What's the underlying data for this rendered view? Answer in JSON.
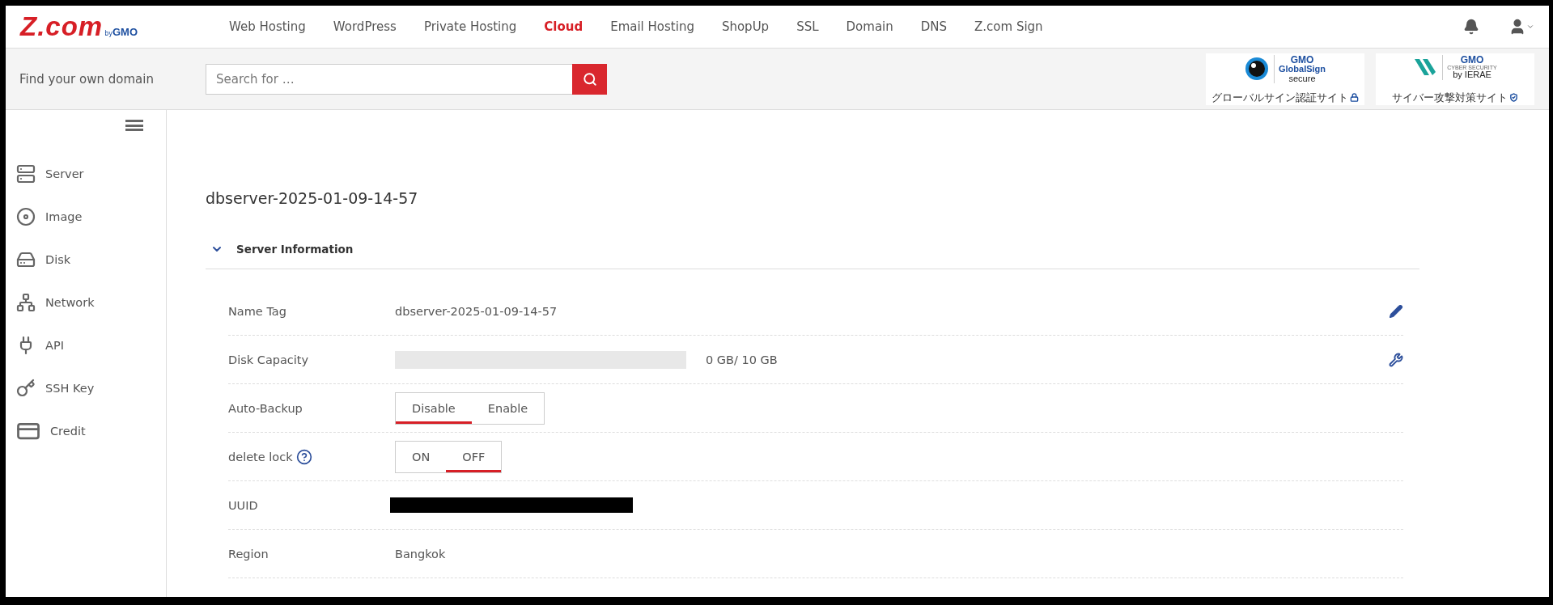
{
  "logo": {
    "brand": "Z.com",
    "by": "by",
    "gmo": "GMO"
  },
  "nav": [
    {
      "label": "Web Hosting",
      "selected": false
    },
    {
      "label": "WordPress",
      "selected": false
    },
    {
      "label": "Private Hosting",
      "selected": false
    },
    {
      "label": "Cloud",
      "selected": true
    },
    {
      "label": "Email Hosting",
      "selected": false
    },
    {
      "label": "ShopUp",
      "selected": false
    },
    {
      "label": "SSL",
      "selected": false
    },
    {
      "label": "Domain",
      "selected": false
    },
    {
      "label": "DNS",
      "selected": false
    },
    {
      "label": "Z.com Sign",
      "selected": false
    }
  ],
  "search": {
    "label": "Find your own domain",
    "placeholder": "Search for …"
  },
  "badges": [
    {
      "kind": "globalsign",
      "gmo": "GMO",
      "title": "GlobalSign",
      "subtitle": "secure",
      "caption": "グローバルサイン認証サイト"
    },
    {
      "kind": "ierae",
      "gmo": "GMO",
      "title": "CYBER SECURITY",
      "subtitle": "by IERAE",
      "caption": "サイバー攻撃対策サイト"
    }
  ],
  "sidebar": {
    "items": [
      {
        "kind": "server",
        "label": "Server"
      },
      {
        "kind": "image",
        "label": "Image"
      },
      {
        "kind": "disk",
        "label": "Disk"
      },
      {
        "kind": "network",
        "label": "Network"
      },
      {
        "kind": "api",
        "label": "API"
      },
      {
        "kind": "ssh",
        "label": "SSH Key"
      },
      {
        "kind": "credit",
        "label": "Credit"
      }
    ]
  },
  "page_title": "dbserver-2025-01-09-14-57",
  "section": {
    "title": "Server Information",
    "expanded": true
  },
  "rows": [
    {
      "kind": "text",
      "label": "Name Tag",
      "value": "dbserver-2025-01-09-14-57",
      "edit": true
    },
    {
      "kind": "meter",
      "label": "Disk Capacity",
      "level": 0,
      "reading": "0 GB/ 10 GB",
      "tools": true
    },
    {
      "kind": "toggle",
      "label": "Auto-Backup",
      "options": [
        {
          "label": "Disable",
          "selected": true
        },
        {
          "label": "Enable",
          "selected": false
        }
      ]
    },
    {
      "kind": "toggle",
      "label": "delete lock",
      "help": true,
      "options": [
        {
          "label": "ON",
          "selected": false
        },
        {
          "label": "OFF",
          "selected": true
        }
      ]
    },
    {
      "kind": "redacted",
      "label": "UUID"
    },
    {
      "kind": "text",
      "label": "Region",
      "value": "Bangkok"
    }
  ]
}
